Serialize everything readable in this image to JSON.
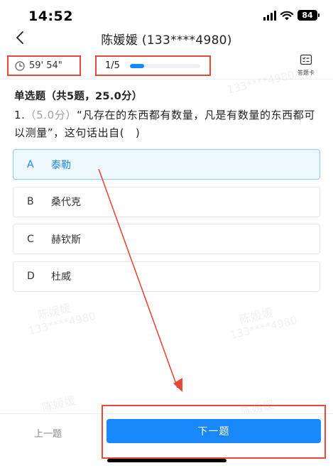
{
  "status_bar": {
    "time": "14:52",
    "battery": "84"
  },
  "nav": {
    "title": "陈媛媛 (133****4980)"
  },
  "toolbar": {
    "timer": "59' 54\"",
    "progress_text": "1/5",
    "progress_fraction": 0.2,
    "answer_card_label": "答题卡"
  },
  "question": {
    "section_heading": "单选题（共5题，25.0分）",
    "number": "1.",
    "score": "（5.0分）",
    "text": "“凡存在的东西都有数量，凡是有数量的东西都可以测量”，这句话出自(　)"
  },
  "options": [
    {
      "letter": "A",
      "text": "泰勒",
      "selected": true
    },
    {
      "letter": "B",
      "text": "桑代克",
      "selected": false
    },
    {
      "letter": "C",
      "text": "赫钦斯",
      "selected": false
    },
    {
      "letter": "D",
      "text": "杜威",
      "selected": false
    }
  ],
  "watermark": {
    "name": "陈媛媛",
    "phone": "133****4980"
  },
  "bottom": {
    "prev_label": "上一题",
    "next_label": "下一题"
  },
  "colors": {
    "accent": "#1989fa",
    "annotation": "#e34a3c",
    "selected_bg": "#eef7fe"
  }
}
